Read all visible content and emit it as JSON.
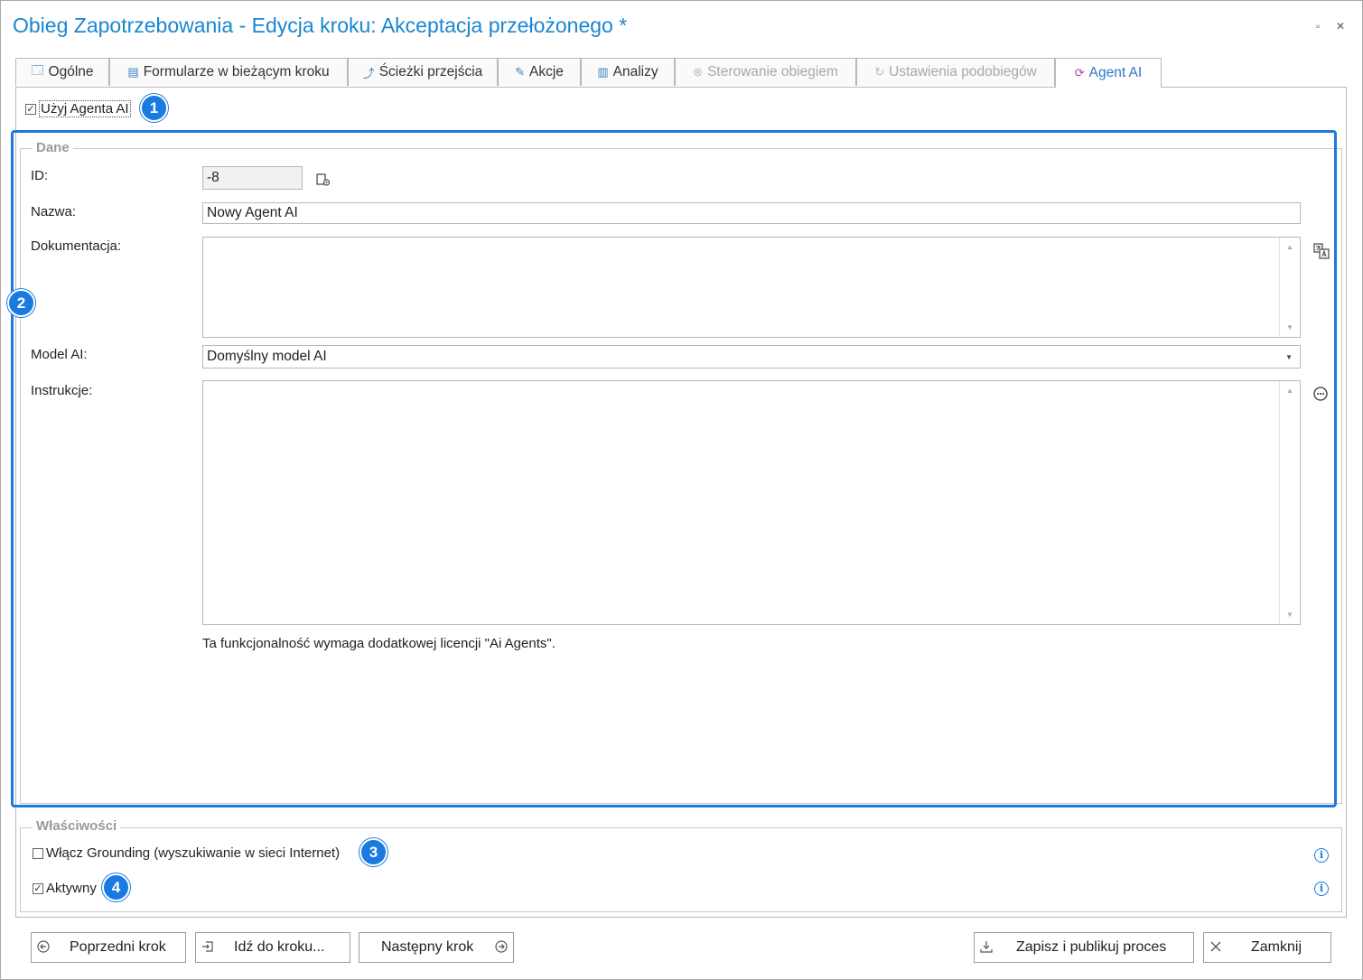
{
  "window": {
    "title": "Obieg Zapotrzebowania - Edycja kroku: Akceptacja przełożonego *",
    "maximize_glyph": "▫",
    "close_glyph": "✕"
  },
  "tabs": [
    {
      "label": "Ogólne",
      "icon": "window-icon",
      "glyph": "🗔",
      "state": "normal"
    },
    {
      "label": "Formularze w bieżącym kroku",
      "icon": "form-icon",
      "glyph": "▤",
      "state": "normal"
    },
    {
      "label": "Ścieżki przejścia",
      "icon": "path-icon",
      "glyph": "⤴",
      "state": "normal"
    },
    {
      "label": "Akcje",
      "icon": "action-icon",
      "glyph": "✎",
      "state": "normal"
    },
    {
      "label": "Analizy",
      "icon": "chart-icon",
      "glyph": "▥",
      "state": "normal"
    },
    {
      "label": "Sterowanie obiegiem",
      "icon": "control-icon",
      "glyph": "⊗",
      "state": "disabled"
    },
    {
      "label": "Ustawienia podobiegów",
      "icon": "subflow-icon",
      "glyph": "↻",
      "state": "disabled"
    },
    {
      "label": "Agent AI",
      "icon": "ai-agent-icon",
      "glyph": "⟳",
      "state": "active"
    }
  ],
  "use_agent": {
    "label": "Użyj Agenta AI",
    "checked": true,
    "check_glyph": "✓"
  },
  "badges": [
    "1",
    "2",
    "3",
    "4"
  ],
  "dane": {
    "legend": "Dane",
    "id_label": "ID:",
    "id_value": "-8",
    "name_label": "Nazwa:",
    "name_value": "Nowy Agent AI",
    "doc_label": "Dokumentacja:",
    "doc_value": "",
    "model_label": "Model AI:",
    "model_value": "Domyślny model AI",
    "instr_label": "Instrukcje:",
    "instr_value": "",
    "license_note": "Ta funkcjonalność wymaga dodatkowej licencji \"Ai Agents\"."
  },
  "wlasciwosci": {
    "legend": "Właściwości",
    "grounding_label": "Włącz Grounding (wyszukiwanie w sieci Internet)",
    "grounding_checked": false,
    "active_label": "Aktywny",
    "active_checked": true,
    "check_glyph": "✓",
    "info_glyph": "i"
  },
  "buttons": {
    "prev": "Poprzedni krok",
    "goto": "Idź do kroku...",
    "next": "Następny krok",
    "save": "Zapisz i publikuj proces",
    "close": "Zamknij"
  },
  "colors": {
    "accent": "#1a7ae0",
    "title": "#1a86d0",
    "active_tab": "#2b78c5"
  }
}
